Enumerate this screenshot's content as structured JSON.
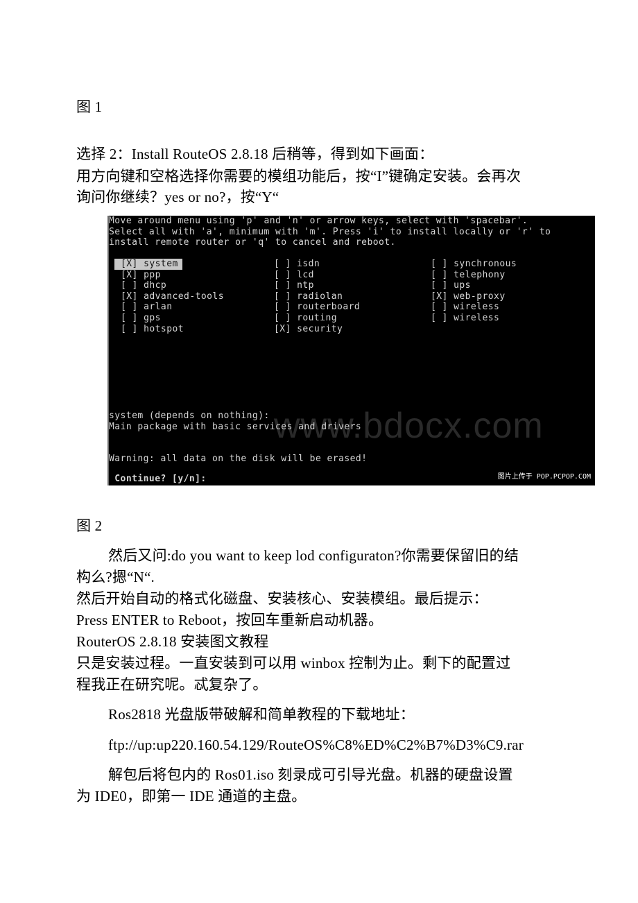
{
  "document": {
    "caption_fig1": "图 1",
    "para_step2": "选择 2：Install RouteOS 2.8.18 后稍等，得到如下画面：",
    "para_keys_line1": "用方向键和空格选择你需要的模组功能后，按“I”键确定安装。会再次",
    "para_keys_line2": "询问你继续？yes or no?，按“Y“",
    "caption_fig2": "图 2",
    "para_config_line1": "然后又问:do you want to keep lod configuraton?你需要保留旧的结",
    "para_config_line2": "构么?摁“N“.",
    "para_format": "然后开始自动的格式化磁盘、安装核心、安装模组。最后提示：",
    "para_reboot": "Press ENTER to Reboot，按回车重新启动机器。",
    "para_title": "RouterOS 2.8.18 安装图文教程",
    "para_note_line1": "只是安装过程。一直安装到可以用 winbox 控制为止。剩下的配置过",
    "para_note_line2": "程我正在研究呢。忒复杂了。",
    "para_download": "Ros2818 光盘版带破解和简单教程的下载地址：",
    "para_url": "ftp://up:up220.160.54.129/RouteOS%C8%ED%C2%B7%D3%C9.rar",
    "para_iso_line1": "解包后将包内的 Ros01.iso 刻录成可引导光盘。机器的硬盘设置",
    "para_iso_line2": "为 IDE0，即第一 IDE 通道的主盘。"
  },
  "terminal": {
    "instructions": [
      "Move around menu using 'p' and 'n' or arrow keys, select with 'spacebar'.",
      "Select all with 'a', minimum with 'm'. Press 'i' to install locally or 'r' to",
      "install remote router or 'q' to cancel and reboot."
    ],
    "packages": [
      {
        "label": "[X] system",
        "checked": true,
        "selected": true
      },
      {
        "label": "[X] ppp",
        "checked": true
      },
      {
        "label": "[ ] dhcp",
        "checked": false
      },
      {
        "label": "[X] advanced-tools",
        "checked": true
      },
      {
        "label": "[ ] arlan",
        "checked": false
      },
      {
        "label": "[ ] gps",
        "checked": false
      },
      {
        "label": "[ ] hotspot",
        "checked": false
      },
      {
        "label": "[ ] isdn",
        "checked": false
      },
      {
        "label": "[ ] lcd",
        "checked": false
      },
      {
        "label": "[ ] ntp",
        "checked": false
      },
      {
        "label": "[ ] radiolan",
        "checked": false
      },
      {
        "label": "[ ] routerboard",
        "checked": false
      },
      {
        "label": "[ ] routing",
        "checked": false
      },
      {
        "label": "[X] security",
        "checked": true
      },
      {
        "label": "[ ] synchronous",
        "checked": false
      },
      {
        "label": "[ ] telephony",
        "checked": false
      },
      {
        "label": "[ ] ups",
        "checked": false
      },
      {
        "label": "[X] web-proxy",
        "checked": true
      },
      {
        "label": "[ ] wireless",
        "checked": false
      },
      {
        "label": "[ ] wireless",
        "checked": false
      }
    ],
    "description_title": "system (depends on nothing):",
    "description_text": "Main package with basic services and drivers",
    "warning": "Warning: all data on the disk will be erased!",
    "prompt": " Continue? [y/n]:",
    "watermark": "www.bdocx.com",
    "credit": "图片上传于 POP.PCPOP.COM"
  }
}
